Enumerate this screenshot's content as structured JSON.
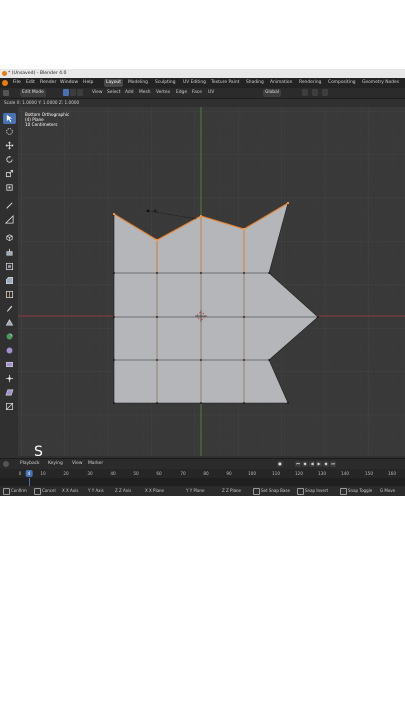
{
  "window": {
    "title": "* (Unsaved) - Blender 4.0"
  },
  "menu": {
    "items": [
      "File",
      "Edit",
      "Render",
      "Window",
      "Help"
    ]
  },
  "workspaces": [
    "Layout",
    "Modeling",
    "Sculpting",
    "UV Editing",
    "Texture Paint",
    "Shading",
    "Animation",
    "Rendering",
    "Compositing",
    "Geometry Nodes"
  ],
  "active_workspace": "Layout",
  "header": {
    "mode": "Edit Mode",
    "menus": [
      "View",
      "Select",
      "Add",
      "Mesh",
      "Vertex",
      "Edge",
      "Face",
      "UV"
    ],
    "orientation": "Global"
  },
  "scale_readout": "Scale X: 1.0000   Y: 1.0000   Z: 1.0000",
  "viewport": {
    "view_name": "Bottom Orthographic",
    "object": "(4) Plane",
    "grid_unit": "10 Centimeters",
    "background": "#393939",
    "mesh_fill": "#b4b6b9",
    "selected_edge": "#e8822c",
    "axis_x": "#8a3a3a",
    "axis_y": "#4d8a3a"
  },
  "key_overlay": "S",
  "toolbar_icons": [
    "select-box-icon",
    "cursor-icon",
    "move-icon",
    "rotate-icon",
    "scale-icon",
    "transform-icon",
    "annotate-icon",
    "measure-icon",
    "add-cube-icon",
    "extrude-icon",
    "inset-icon",
    "bevel-icon",
    "loop-cut-icon",
    "knife-icon",
    "poly-build-icon",
    "spin-icon",
    "smooth-icon",
    "edge-slide-icon",
    "shrink-fatten-icon",
    "shear-icon",
    "rip-icon"
  ],
  "timeline": {
    "menus": [
      "Playback",
      "Keying",
      "View",
      "Marker"
    ],
    "ticks": [
      "0",
      "10",
      "20",
      "30",
      "40",
      "50",
      "60",
      "70",
      "80",
      "90",
      "100",
      "110",
      "120",
      "130",
      "140",
      "150",
      "160"
    ],
    "current_frame": "4"
  },
  "status": [
    {
      "key": "",
      "label": "Confirm"
    },
    {
      "key": "",
      "label": "Cancel"
    },
    {
      "key": "X",
      "label": "X Axis"
    },
    {
      "key": "Y",
      "label": "Y Axis"
    },
    {
      "key": "Z",
      "label": "Z Axis"
    },
    {
      "key": "X",
      "label": "X Plane"
    },
    {
      "key": "Y",
      "label": "Y Plane"
    },
    {
      "key": "Z",
      "label": "Z Plane"
    },
    {
      "key": "",
      "label": "Set Snap Base"
    },
    {
      "key": "",
      "label": "Snap Invert"
    },
    {
      "key": "",
      "label": "Snap Toggle"
    },
    {
      "key": "G",
      "label": "Move"
    }
  ]
}
